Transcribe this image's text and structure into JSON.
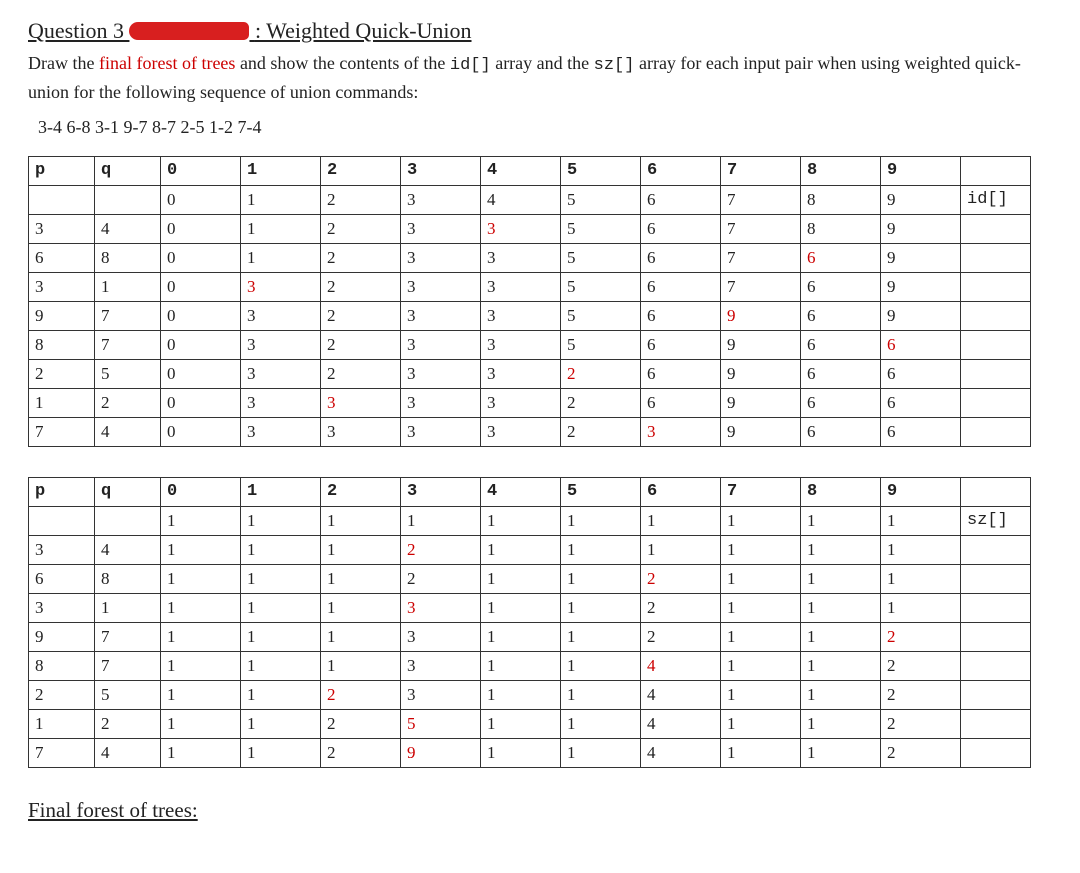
{
  "title_a": "Question 3 ",
  "title_b": ": Weighted Quick-Union",
  "prompt_pre": "Draw the ",
  "prompt_red": "final forest of trees",
  "prompt_mid1": " and show the contents of the ",
  "prompt_code1": "id[]",
  "prompt_mid2": " array and the ",
  "prompt_code2": "sz[]",
  "prompt_mid3": " array for each input pair when using weighted quick-union for the following sequence of union commands:",
  "sequence": "3-4 6-8 3-1 9-7 8-7 2-5 1-2 7-4",
  "id_table": {
    "head_p": "p",
    "head_q": "q",
    "cols": [
      "0",
      "1",
      "2",
      "3",
      "4",
      "5",
      "6",
      "7",
      "8",
      "9"
    ],
    "label": "id[]",
    "rows": [
      {
        "p": "",
        "q": "",
        "v": [
          "0",
          "1",
          "2",
          "3",
          "4",
          "5",
          "6",
          "7",
          "8",
          "9"
        ],
        "red": []
      },
      {
        "p": "3",
        "q": "4",
        "v": [
          "0",
          "1",
          "2",
          "3",
          "3",
          "5",
          "6",
          "7",
          "8",
          "9"
        ],
        "red": [
          4
        ]
      },
      {
        "p": "6",
        "q": "8",
        "v": [
          "0",
          "1",
          "2",
          "3",
          "3",
          "5",
          "6",
          "7",
          "6",
          "9"
        ],
        "red": [
          8
        ]
      },
      {
        "p": "3",
        "q": "1",
        "v": [
          "0",
          "3",
          "2",
          "3",
          "3",
          "5",
          "6",
          "7",
          "6",
          "9"
        ],
        "red": [
          1
        ]
      },
      {
        "p": "9",
        "q": "7",
        "v": [
          "0",
          "3",
          "2",
          "3",
          "3",
          "5",
          "6",
          "9",
          "6",
          "9"
        ],
        "red": [
          7
        ]
      },
      {
        "p": "8",
        "q": "7",
        "v": [
          "0",
          "3",
          "2",
          "3",
          "3",
          "5",
          "6",
          "9",
          "6",
          "6"
        ],
        "red": [
          9
        ]
      },
      {
        "p": "2",
        "q": "5",
        "v": [
          "0",
          "3",
          "2",
          "3",
          "3",
          "2",
          "6",
          "9",
          "6",
          "6"
        ],
        "red": [
          5
        ]
      },
      {
        "p": "1",
        "q": "2",
        "v": [
          "0",
          "3",
          "3",
          "3",
          "3",
          "2",
          "6",
          "9",
          "6",
          "6"
        ],
        "red": [
          2
        ]
      },
      {
        "p": "7",
        "q": "4",
        "v": [
          "0",
          "3",
          "3",
          "3",
          "3",
          "2",
          "3",
          "9",
          "6",
          "6"
        ],
        "red": [
          6
        ]
      }
    ]
  },
  "sz_table": {
    "head_p": "p",
    "head_q": "q",
    "cols": [
      "0",
      "1",
      "2",
      "3",
      "4",
      "5",
      "6",
      "7",
      "8",
      "9"
    ],
    "label": "sz[]",
    "rows": [
      {
        "p": "",
        "q": "",
        "v": [
          "1",
          "1",
          "1",
          "1",
          "1",
          "1",
          "1",
          "1",
          "1",
          "1"
        ],
        "red": []
      },
      {
        "p": "3",
        "q": "4",
        "v": [
          "1",
          "1",
          "1",
          "2",
          "1",
          "1",
          "1",
          "1",
          "1",
          "1"
        ],
        "red": [
          3
        ]
      },
      {
        "p": "6",
        "q": "8",
        "v": [
          "1",
          "1",
          "1",
          "2",
          "1",
          "1",
          "2",
          "1",
          "1",
          "1"
        ],
        "red": [
          6
        ]
      },
      {
        "p": "3",
        "q": "1",
        "v": [
          "1",
          "1",
          "1",
          "3",
          "1",
          "1",
          "2",
          "1",
          "1",
          "1"
        ],
        "red": [
          3
        ]
      },
      {
        "p": "9",
        "q": "7",
        "v": [
          "1",
          "1",
          "1",
          "3",
          "1",
          "1",
          "2",
          "1",
          "1",
          "2"
        ],
        "red": [
          9
        ]
      },
      {
        "p": "8",
        "q": "7",
        "v": [
          "1",
          "1",
          "1",
          "3",
          "1",
          "1",
          "4",
          "1",
          "1",
          "2"
        ],
        "red": [
          6
        ]
      },
      {
        "p": "2",
        "q": "5",
        "v": [
          "1",
          "1",
          "2",
          "3",
          "1",
          "1",
          "4",
          "1",
          "1",
          "2"
        ],
        "red": [
          2
        ]
      },
      {
        "p": "1",
        "q": "2",
        "v": [
          "1",
          "1",
          "2",
          "5",
          "1",
          "1",
          "4",
          "1",
          "1",
          "2"
        ],
        "red": [
          3
        ]
      },
      {
        "p": "7",
        "q": "4",
        "v": [
          "1",
          "1",
          "2",
          "9",
          "1",
          "1",
          "4",
          "1",
          "1",
          "2"
        ],
        "red": [
          3
        ]
      }
    ]
  },
  "final_heading": "Final forest of trees:"
}
